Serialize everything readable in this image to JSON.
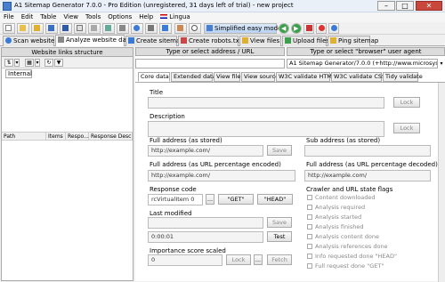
{
  "window": {
    "title": "A1 Sitemap Generator 7.0.0 - Pro Edition (unregistered, 31 days left of trial) - new project"
  },
  "menu": [
    "File",
    "Edit",
    "Table",
    "View",
    "Tools",
    "Options",
    "Help",
    "Lingua"
  ],
  "toolbar": {
    "simplified_mode": "Simplified easy mode"
  },
  "main_tabs": [
    "Scan website",
    "Analyze website data",
    "Create sitemap",
    "Create robots.txt",
    "View files",
    "Upload files",
    "Ping sitemap"
  ],
  "left": {
    "header": "Website links structure",
    "internal_tab": "Internal",
    "columns": [
      "Path",
      "Items",
      "Respo...",
      "Response Desc"
    ]
  },
  "right": {
    "address_header": "Type or select address / URL",
    "agent_header": "Type or select \"browser\" user agent",
    "agent_value": "A1 Sitemap Generator/7.0.0 (+http://www.microsystoc",
    "sub_tabs": [
      "Core data",
      "Extended data",
      "View file",
      "View source",
      "W3C validate HTML",
      "W3C validate CSS",
      "Tidy validate"
    ],
    "title_label": "Title",
    "description_label": "Description",
    "lock": "Lock",
    "full_address_label": "Full address (as stored)",
    "full_address_value": "http://example.com/",
    "save": "Save",
    "sub_address_label": "Sub address (as stored)",
    "encoded_label": "Full address (as URL percentage encoded)",
    "encoded_value": "http://example.com/",
    "decoded_label": "Full address (as URL percentage decoded)",
    "decoded_value": "http://example.com/",
    "response_code_label": "Response code",
    "response_code_value": "rcVirtualItem 0",
    "ellipsis": "...",
    "get_button": "\"GET\"",
    "head_button": "\"HEAD\"",
    "last_modified_label": "Last modified",
    "time_value": "0:00:01",
    "test": "Test",
    "importance_label": "Importance score scaled",
    "importance_value": "0",
    "fetch": "Fetch",
    "flags_label": "Crawler and URL state flags",
    "flags": [
      "Content downloaded",
      "Analysis required",
      "Analysis started",
      "Analysis finished",
      "Analysis content done",
      "Analysis references done",
      "Info requested done \"HEAD\"",
      "Full request done \"GET\""
    ]
  }
}
